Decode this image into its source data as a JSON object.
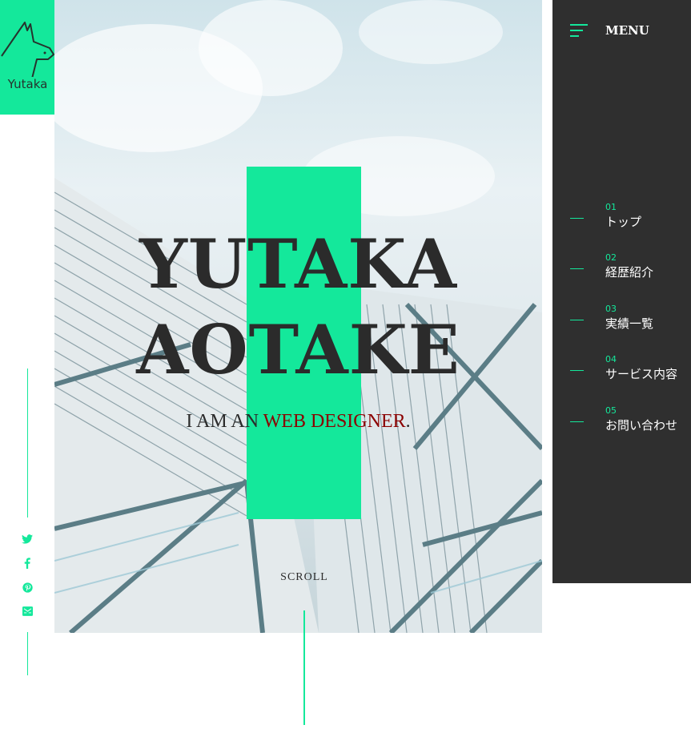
{
  "logo": {
    "text": "Yutaka",
    "icon": "dog-icon"
  },
  "hero": {
    "title_line1": "YUTAKA",
    "title_line2": "AOTAKE",
    "subtitle_prefix": "I AM AN ",
    "subtitle_accent": "WEB DESIGNER",
    "subtitle_suffix": ".",
    "scroll": "SCROLL"
  },
  "social": [
    {
      "icon": "twitter-icon"
    },
    {
      "icon": "facebook-icon"
    },
    {
      "icon": "pinterest-icon"
    },
    {
      "icon": "mail-icon"
    }
  ],
  "menu": {
    "label": "MENU",
    "items": [
      {
        "num": "01",
        "label": "トップ"
      },
      {
        "num": "02",
        "label": "経歴紹介"
      },
      {
        "num": "03",
        "label": "実績一覧"
      },
      {
        "num": "04",
        "label": "サービス内容"
      },
      {
        "num": "05",
        "label": "お問い合わせ"
      }
    ]
  },
  "colors": {
    "accent": "#14e89b",
    "menu_bg": "#2f2f2f",
    "title": "#2b2b2b",
    "highlight": "#8b0000"
  }
}
